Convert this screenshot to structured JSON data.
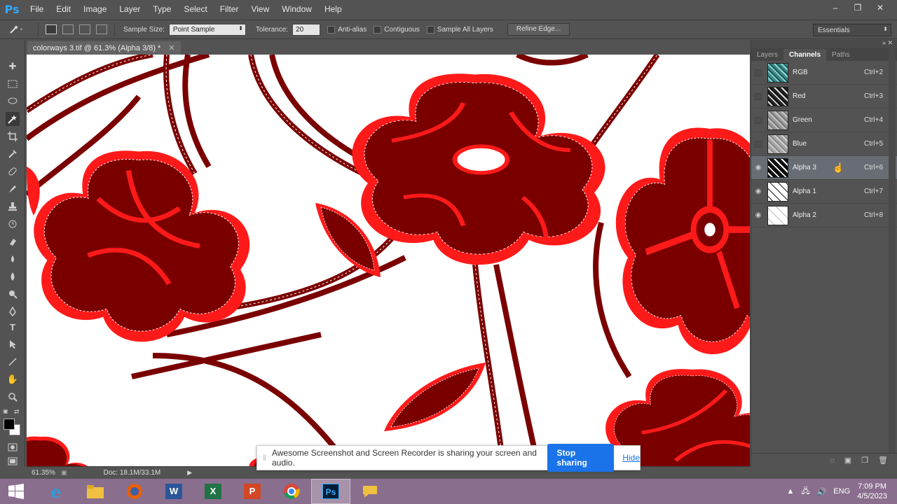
{
  "app": {
    "logo": "Ps"
  },
  "menu": [
    "File",
    "Edit",
    "Image",
    "Layer",
    "Type",
    "Select",
    "Filter",
    "View",
    "Window",
    "Help"
  ],
  "options": {
    "sample_size_label": "Sample Size:",
    "sample_size_value": "Point Sample",
    "tolerance_label": "Tolerance:",
    "tolerance_value": "20",
    "anti_alias": "Anti-alias",
    "contiguous": "Contiguous",
    "sample_all_layers": "Sample All Layers",
    "refine_edge": "Refine Edge...",
    "workspace": "Essentials"
  },
  "document": {
    "tab_title": "colorways 3.tif @ 61.3% (Alpha 3/8) *",
    "zoom": "61.35%",
    "doc_size": "Doc: 18.1M/33.1M"
  },
  "panel": {
    "tabs": [
      "Layers",
      "Channels",
      "Paths"
    ],
    "active_tab": "Channels",
    "channels": [
      {
        "name": "RGB",
        "shortcut": "Ctrl+2",
        "visible": false,
        "thumb": "#3a8a8a"
      },
      {
        "name": "Red",
        "shortcut": "Ctrl+3",
        "visible": false,
        "thumb": "#222222"
      },
      {
        "name": "Green",
        "shortcut": "Ctrl+4",
        "visible": false,
        "thumb": "#9a9a9a"
      },
      {
        "name": "Blue",
        "shortcut": "Ctrl+5",
        "visible": false,
        "thumb": "#a5a5a5"
      },
      {
        "name": "Alpha 3",
        "shortcut": "Ctrl+6",
        "visible": true,
        "thumb": "#111111"
      },
      {
        "name": "Alpha 1",
        "shortcut": "Ctrl+7",
        "visible": true,
        "thumb": "#dddddd"
      },
      {
        "name": "Alpha 2",
        "shortcut": "Ctrl+8",
        "visible": true,
        "thumb": "#f4f4f4"
      }
    ],
    "selected_channel": "Alpha 3"
  },
  "sharebar": {
    "message": "Awesome Screenshot and Screen Recorder is sharing your screen and audio.",
    "stop": "Stop sharing",
    "hide": "Hide"
  },
  "taskbar": {
    "language": "ENG",
    "time": "7:09 PM",
    "date": "4/5/2023",
    "apps": [
      "internet-explorer",
      "file-explorer",
      "firefox",
      "word",
      "excel",
      "powerpoint",
      "chrome",
      "photoshop",
      "messages"
    ]
  },
  "colors": {
    "pattern_dark": "#7a0000",
    "pattern_outline": "#ff1a1a",
    "accent": "#1a73e8"
  }
}
